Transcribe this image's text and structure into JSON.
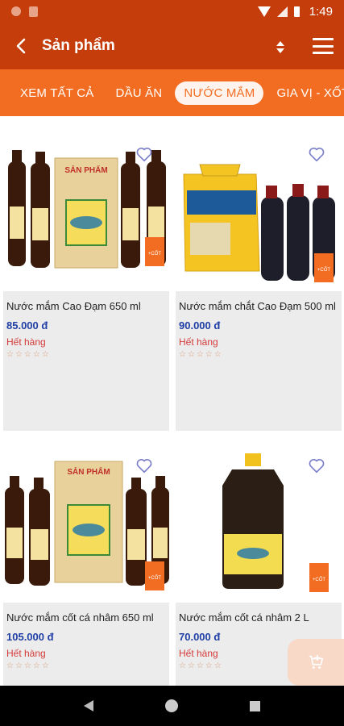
{
  "status": {
    "time": "1:49"
  },
  "header": {
    "title": "Sản phẩm"
  },
  "tabs": [
    {
      "label": "XEM TẤT CẢ"
    },
    {
      "label": "DẦU ĂN"
    },
    {
      "label": "NƯỚC MẮM"
    },
    {
      "label": "GIA VỊ - XỐT"
    }
  ],
  "products": [
    {
      "name": "Nước mắm Cao Đạm 650 ml",
      "price": "85.000 đ",
      "stock": "Hết hàng",
      "stars": "☆☆☆☆☆"
    },
    {
      "name": "Nước mắm chắt Cao Đạm 500 ml",
      "price": "90.000 đ",
      "stock": "Hết hàng",
      "stars": "☆☆☆☆☆"
    },
    {
      "name": "Nước mắm cốt cá nhâm 650 ml",
      "price": "105.000 đ",
      "stock": "Hết hàng",
      "stars": "☆☆☆☆☆"
    },
    {
      "name": "Nước mắm cốt cá nhâm 2 L",
      "price": "70.000 đ",
      "stock": "Hết hàng",
      "stars": "☆☆☆☆☆"
    }
  ],
  "box_labels": {
    "brand": "SẢN PHẨM",
    "tag": "+CỐT"
  },
  "colors": {
    "header": "#c43d0b",
    "tabs": "#f26d21",
    "price": "#203fa5",
    "stock": "#d53a3a"
  }
}
